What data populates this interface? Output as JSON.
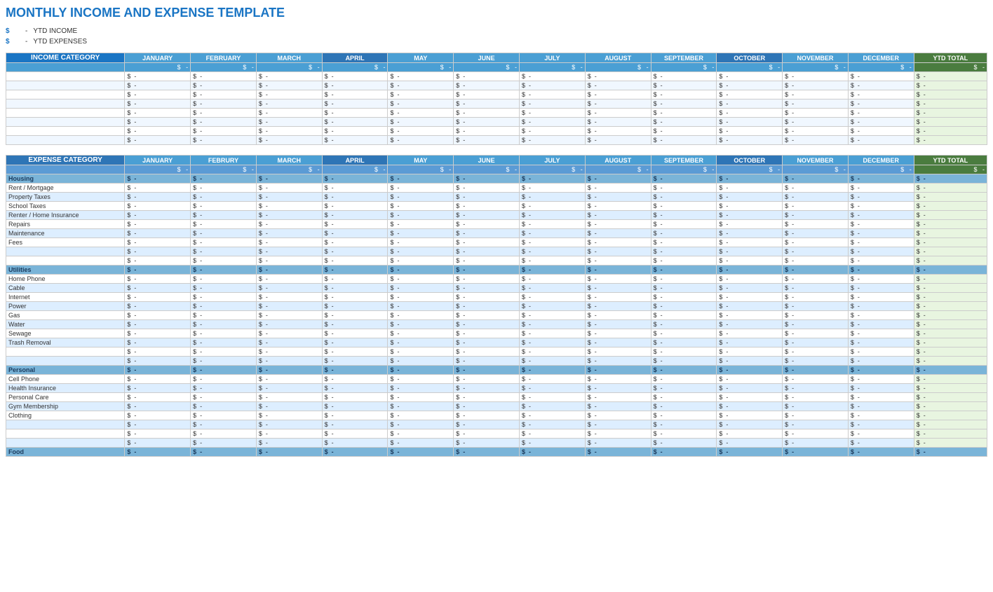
{
  "title": "MONTHLY INCOME AND EXPENSE TEMPLATE",
  "ytd": {
    "income_label": "YTD INCOME",
    "expense_label": "YTD EXPENSES",
    "dollar_sign": "$",
    "dash": "-"
  },
  "months": [
    "JANUARY",
    "FEBRUARY",
    "MARCH",
    "APRIL",
    "MAY",
    "JUNE",
    "JULY",
    "AUGUST",
    "SEPTEMBER",
    "OCTOBER",
    "NOVEMBER",
    "DECEMBER"
  ],
  "months_expense": [
    "JANUARY",
    "FEBRURY",
    "MARCH",
    "APRIL",
    "MAY",
    "JUNE",
    "JULY",
    "AUGUST",
    "SEPTEMBER",
    "OCTOBER",
    "NOVEMBER",
    "DECEMBER"
  ],
  "ytd_total": "YTD TOTAL",
  "income_category_label": "INCOME CATEGORY",
  "expense_category_label": "EXPENSE CATEGORY",
  "dollar": "$",
  "dash_val": "-",
  "expense_categories": {
    "housing": {
      "label": "Housing",
      "items": [
        "Rent / Mortgage",
        "Property Taxes",
        "School Taxes",
        "Renter / Home Insurance",
        "Repairs",
        "Maintenance",
        "Fees",
        "",
        ""
      ]
    },
    "utilities": {
      "label": "Utilities",
      "items": [
        "Home Phone",
        "Cable",
        "Internet",
        "Power",
        "Gas",
        "Water",
        "Sewage",
        "Trash Removal",
        "",
        ""
      ]
    },
    "personal": {
      "label": "Personal",
      "items": [
        "Cell Phone",
        "Health Insurance",
        "Personal Care",
        "Gym Membership",
        "Clothing",
        "",
        "",
        ""
      ]
    },
    "food": {
      "label": "Food",
      "items": []
    }
  }
}
